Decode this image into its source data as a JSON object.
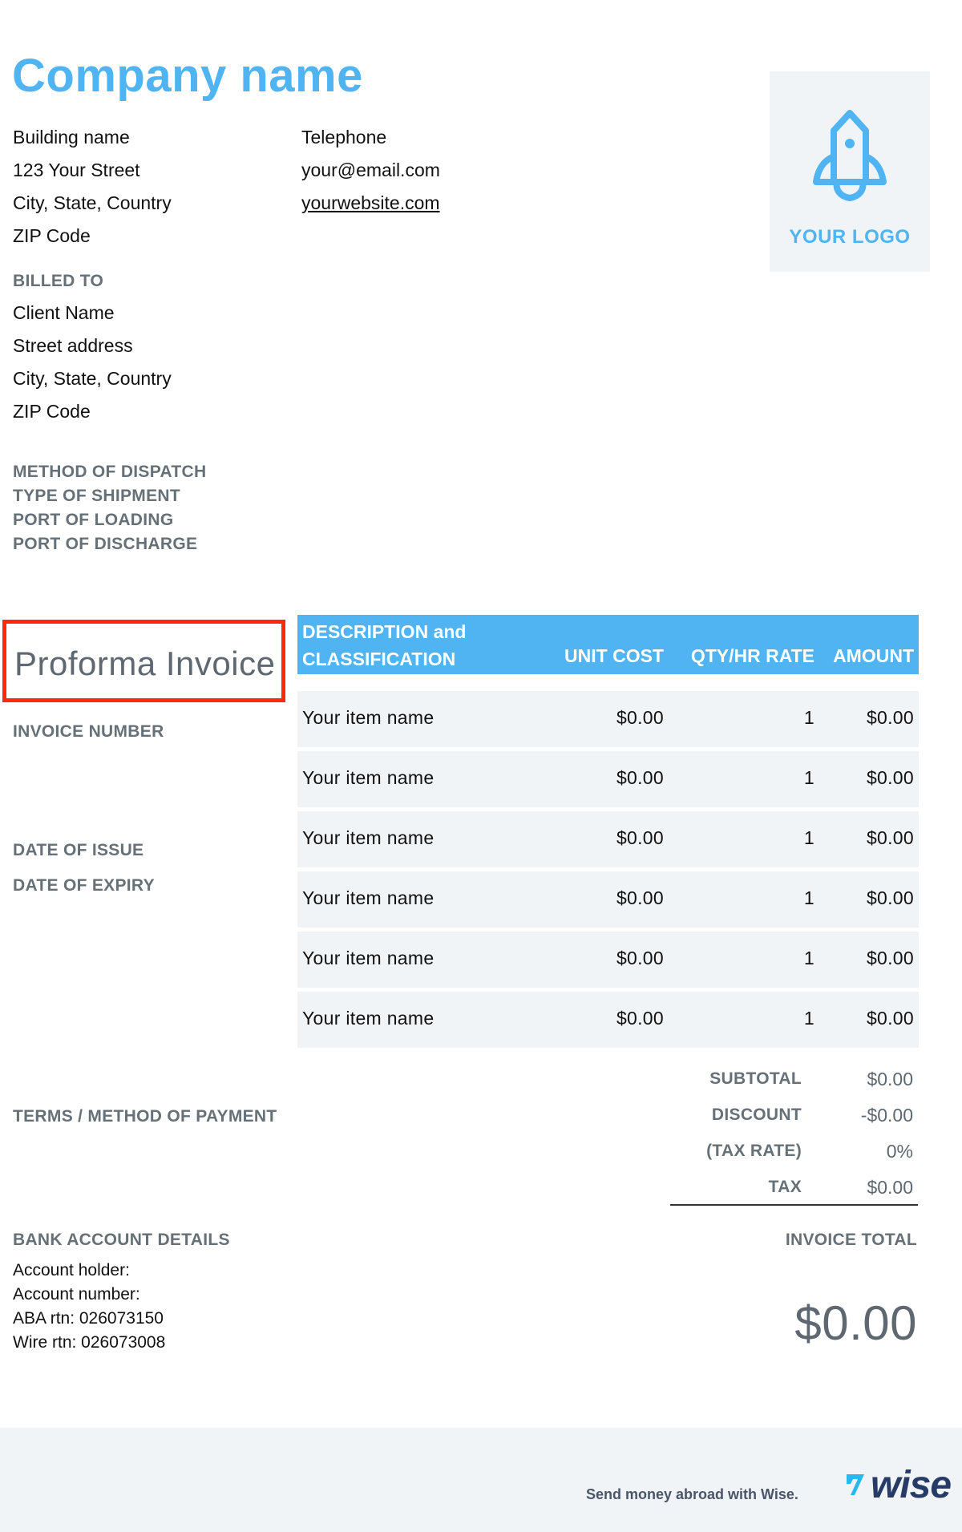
{
  "company": {
    "name": "Company name",
    "address_lines": [
      "Building name",
      "123 Your Street",
      "City, State, Country",
      "ZIP Code"
    ],
    "contact_lines": [
      "Telephone",
      "your@email.com"
    ],
    "website": "yourwebsite.com",
    "logo_text": "YOUR LOGO",
    "logo_icon": "rocket-icon"
  },
  "billed_to": {
    "label": "BILLED TO",
    "lines": [
      "Client Name",
      "Street address",
      "City, State, Country",
      "ZIP Code"
    ]
  },
  "shipping": {
    "labels": [
      "METHOD OF DISPATCH",
      "TYPE OF SHIPMENT",
      "PORT OF LOADING",
      "PORT OF DISCHARGE"
    ]
  },
  "document": {
    "title": "Proforma Invoice",
    "invoice_number_label": "INVOICE NUMBER",
    "date_of_issue_label": "DATE OF ISSUE",
    "date_of_expiry_label": "DATE OF EXPIRY",
    "terms_label": "TERMS / METHOD OF PAYMENT"
  },
  "table": {
    "headers": {
      "description_line1": "DESCRIPTION and",
      "description_line2": "CLASSIFICATION",
      "unit_cost": "UNIT COST",
      "qty": "QTY/HR RATE",
      "amount": "AMOUNT"
    },
    "rows": [
      {
        "description": "Your item name",
        "unit_cost": "$0.00",
        "qty": "1",
        "amount": "$0.00"
      },
      {
        "description": "Your item name",
        "unit_cost": "$0.00",
        "qty": "1",
        "amount": "$0.00"
      },
      {
        "description": "Your item name",
        "unit_cost": "$0.00",
        "qty": "1",
        "amount": "$0.00"
      },
      {
        "description": "Your item name",
        "unit_cost": "$0.00",
        "qty": "1",
        "amount": "$0.00"
      },
      {
        "description": "Your item name",
        "unit_cost": "$0.00",
        "qty": "1",
        "amount": "$0.00"
      },
      {
        "description": "Your item name",
        "unit_cost": "$0.00",
        "qty": "1",
        "amount": "$0.00"
      }
    ]
  },
  "totals": {
    "rows": [
      {
        "label": "SUBTOTAL",
        "value": "$0.00"
      },
      {
        "label": "DISCOUNT",
        "value": "-$0.00"
      },
      {
        "label": "(TAX RATE)",
        "value": "0%"
      },
      {
        "label": "TAX",
        "value": "$0.00"
      }
    ],
    "invoice_total_label": "INVOICE TOTAL",
    "invoice_total_value": "$0.00"
  },
  "bank": {
    "label": "BANK ACCOUNT DETAILS",
    "lines": [
      "Account holder:",
      "Account number:",
      "ABA rtn: 026073150",
      "Wire rtn: 026073008"
    ]
  },
  "footer": {
    "tagline": "Send money abroad with Wise.",
    "brand": "wise",
    "brand_icon": "wise-flag-icon"
  },
  "colors": {
    "accent": "#4fb4f1",
    "label_gray": "#667077",
    "row_bg": "#f1f4f7",
    "highlight_box": "#ff2a0a",
    "wise_navy": "#263b66"
  }
}
